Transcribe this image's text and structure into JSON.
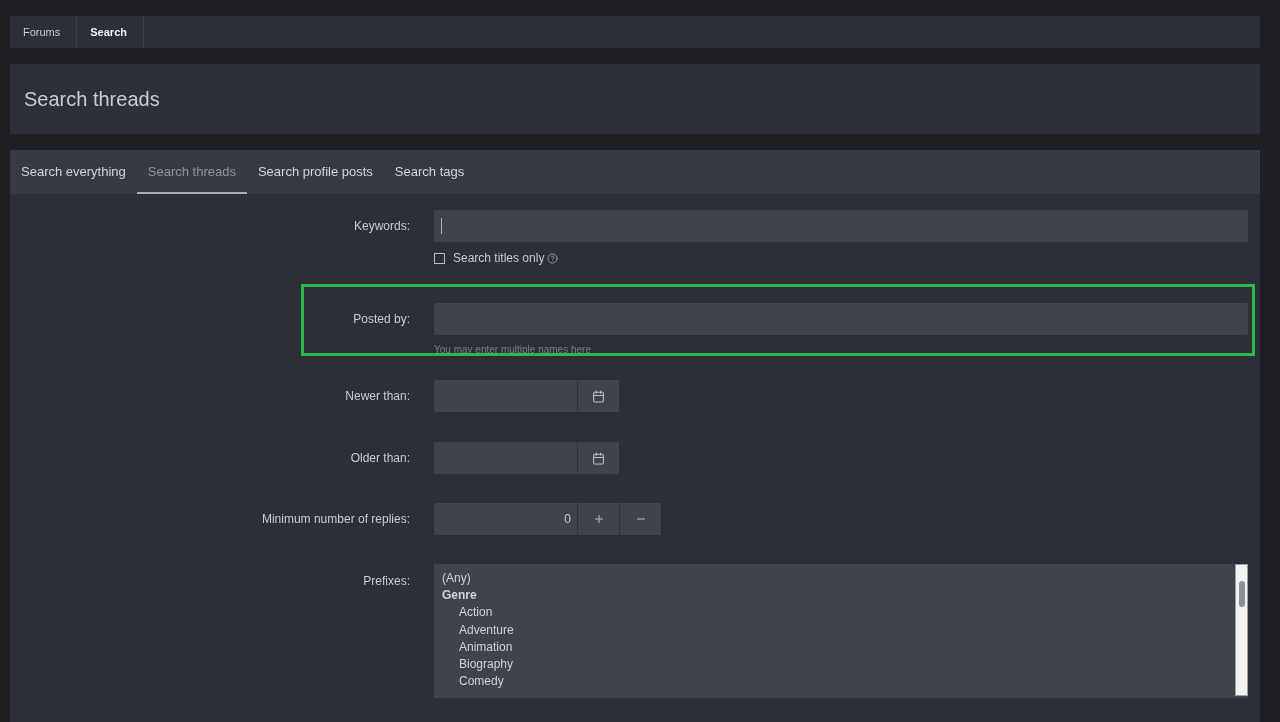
{
  "breadcrumbs": [
    {
      "label": "Forums",
      "current": false
    },
    {
      "label": "Search",
      "current": true
    }
  ],
  "page_title": "Search threads",
  "tabs": [
    {
      "label": "Search everything",
      "selected": false
    },
    {
      "label": "Search threads",
      "selected": true
    },
    {
      "label": "Search profile posts",
      "selected": false
    },
    {
      "label": "Search tags",
      "selected": false
    }
  ],
  "form": {
    "keywords": {
      "label": "Keywords:"
    },
    "titles_only": {
      "label": "Search titles only",
      "checked": false
    },
    "posted_by": {
      "label": "Posted by:",
      "hint": "You may enter multiple names here"
    },
    "newer_than": {
      "label": "Newer than:"
    },
    "older_than": {
      "label": "Older than:"
    },
    "min_replies": {
      "label": "Minimum number of replies:",
      "value": "0"
    },
    "prefixes": {
      "label": "Prefixes:",
      "options": [
        {
          "label": "(Any)"
        },
        {
          "label": "Genre",
          "children": [
            {
              "label": "Action"
            },
            {
              "label": "Adventure"
            },
            {
              "label": "Animation"
            },
            {
              "label": "Biography"
            },
            {
              "label": "Comedy"
            }
          ]
        }
      ]
    }
  }
}
